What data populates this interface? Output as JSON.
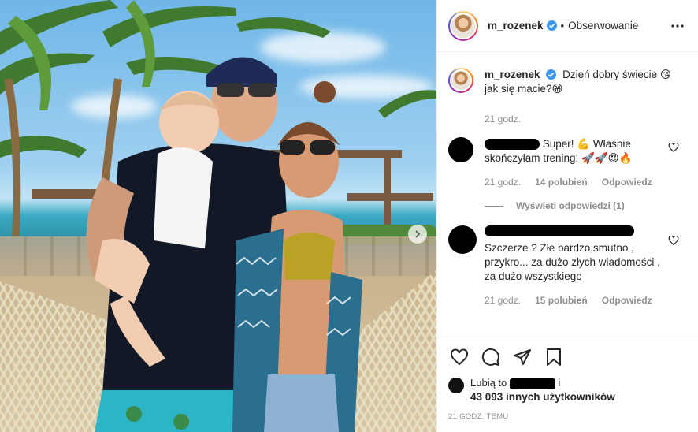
{
  "post": {
    "username": "m_rozenek",
    "follow_status": "Obserwowanie",
    "dot": "•"
  },
  "caption": {
    "username": "m_rozenek",
    "text": "Dzień dobry świecie 😘 jak się macie?😁",
    "time": "21 godz."
  },
  "comments": [
    {
      "username_redacted": true,
      "text": "Super! 💪 Właśnie skończyłam trening! 🚀🚀😍🔥",
      "time": "21 godz.",
      "likes": "14 polubień",
      "reply": "Odpowiedz",
      "view_replies": "Wyświetl odpowiedzi (1)"
    },
    {
      "username_redacted": true,
      "text": "Szczerze ? Złe bardzo,smutno , przykro... za dużo złych wiadomości , za dużo wszystkiego",
      "time": "21 godz.",
      "likes": "15 polubień",
      "reply": "Odpowiedz"
    }
  ],
  "actions": {
    "like_icon": "heart-icon",
    "comment_icon": "comment-icon",
    "share_icon": "paper-plane-icon",
    "save_icon": "bookmark-icon"
  },
  "likes": {
    "prefix": "Lubią to",
    "suffix": "i",
    "others": "43 093 innych użytkowników"
  },
  "timestamp": "21 godz. temu",
  "colors": {
    "verified": "#3897f0",
    "text": "#262626",
    "muted": "#8e8e8e",
    "border": "#efefef"
  }
}
